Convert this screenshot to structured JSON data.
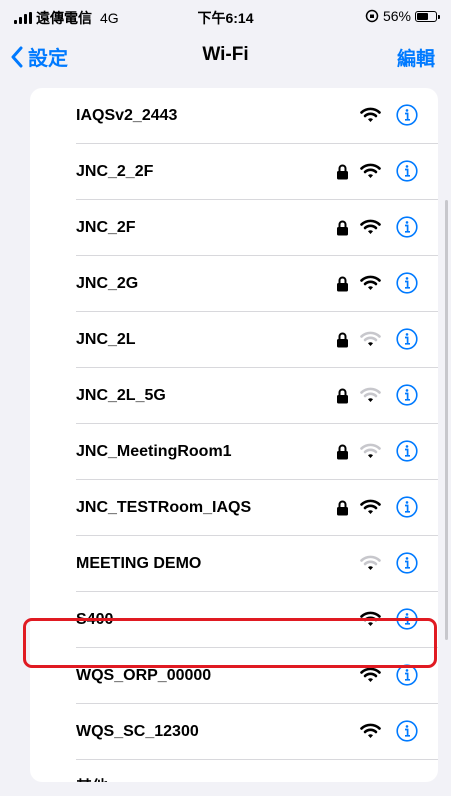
{
  "status_bar": {
    "carrier": "遠傳電信",
    "network": "4G",
    "time": "下午6:14",
    "battery": "56%"
  },
  "nav": {
    "back_label": "設定",
    "title": "Wi-Fi",
    "edit_label": "編輯"
  },
  "networks": [
    {
      "name": "IAQSv2_2443",
      "locked": false,
      "signal": "full"
    },
    {
      "name": "JNC_2_2F",
      "locked": true,
      "signal": "full"
    },
    {
      "name": "JNC_2F",
      "locked": true,
      "signal": "full"
    },
    {
      "name": "JNC_2G",
      "locked": true,
      "signal": "full"
    },
    {
      "name": "JNC_2L",
      "locked": true,
      "signal": "weak"
    },
    {
      "name": "JNC_2L_5G",
      "locked": true,
      "signal": "weak"
    },
    {
      "name": "JNC_MeetingRoom1",
      "locked": true,
      "signal": "weak"
    },
    {
      "name": "JNC_TESTRoom_IAQS",
      "locked": true,
      "signal": "full"
    },
    {
      "name": "MEETING DEMO",
      "locked": false,
      "signal": "weak"
    },
    {
      "name": "S400",
      "locked": false,
      "signal": "full"
    },
    {
      "name": "WQS_ORP_00000",
      "locked": false,
      "signal": "full"
    },
    {
      "name": "WQS_SC_12300",
      "locked": false,
      "signal": "full",
      "highlighted": true
    }
  ],
  "other_label": "其他⋯",
  "colors": {
    "accent": "#007aff",
    "highlight": "#e01a22",
    "background": "#f2f2f7"
  },
  "icons": {
    "lock": "lock-icon",
    "wifi": "wifi-icon",
    "info": "info-icon"
  }
}
